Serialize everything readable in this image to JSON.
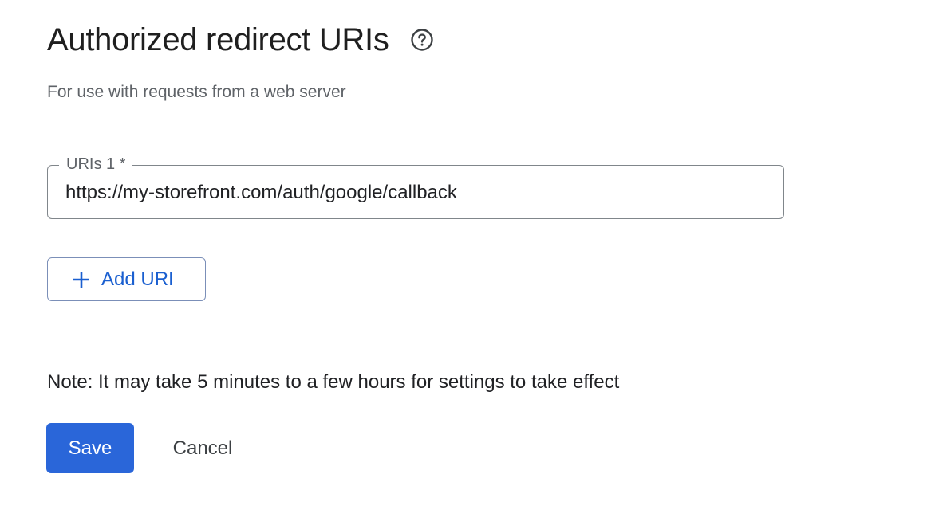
{
  "section": {
    "title": "Authorized redirect URIs",
    "help_icon": "help-circle-icon",
    "subtitle": "For use with requests from a web server"
  },
  "uri_field": {
    "label": "URIs 1 *",
    "value": "https://my-storefront.com/auth/google/callback"
  },
  "add_uri": {
    "icon": "plus-icon",
    "label": "Add URI"
  },
  "note": "Note: It may take 5 minutes to a few hours for settings to take effect",
  "actions": {
    "save_label": "Save",
    "cancel_label": "Cancel"
  },
  "colors": {
    "primary": "#2a66d9",
    "link_blue": "#1a5fd0",
    "text": "#202124",
    "muted": "#5f6368",
    "border": "#80868b"
  }
}
